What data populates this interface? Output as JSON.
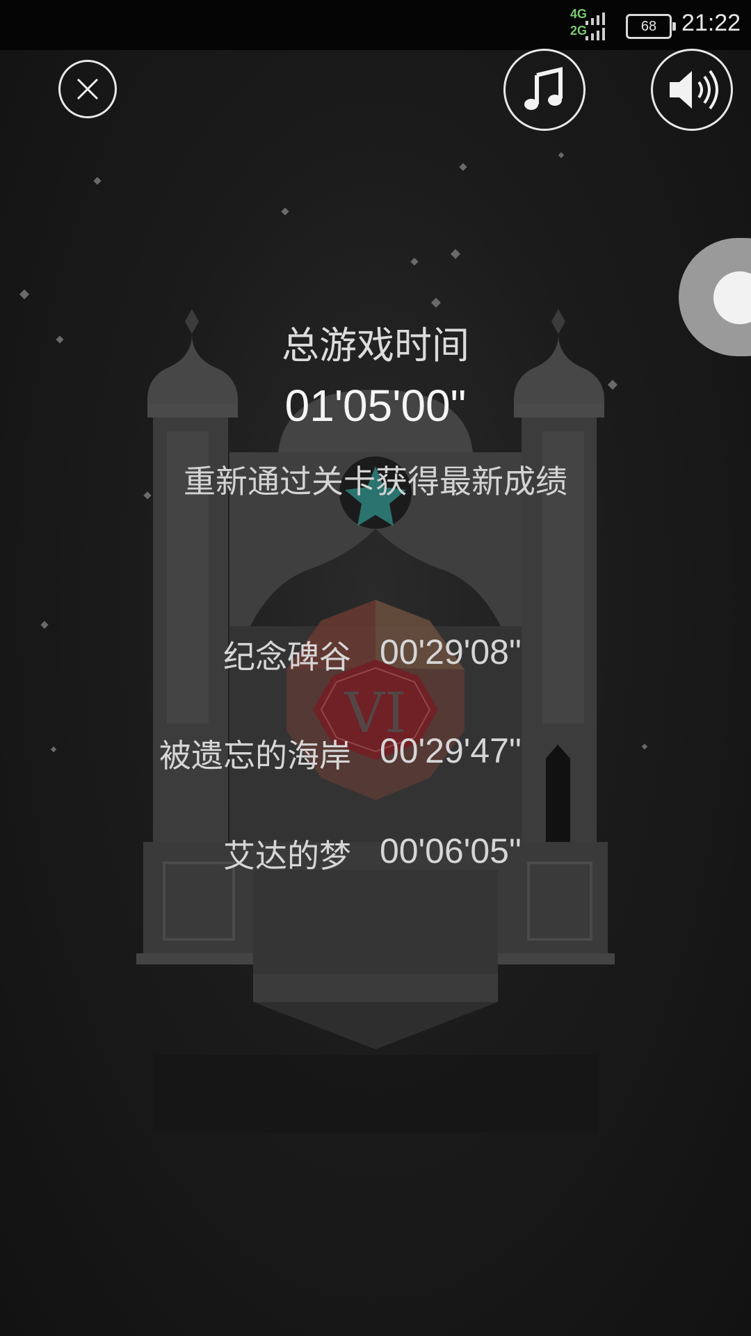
{
  "status_bar": {
    "network_top": "4G",
    "network_bottom": "2G",
    "battery": "68",
    "time": "21:22"
  },
  "controls": {
    "close_icon": "close-icon",
    "music_icon": "music-note-icon",
    "sound_icon": "speaker-volume-icon"
  },
  "summary": {
    "title": "总游戏时间",
    "total_time": "01'05'00\"",
    "hint": "重新通过关卡获得最新成绩"
  },
  "chapters": [
    {
      "name": "纪念碑谷",
      "time": "00'29'08\""
    },
    {
      "name": "被遗忘的海岸",
      "time": "00'29'47\""
    },
    {
      "name": "艾达的梦",
      "time": "00'06'05\""
    }
  ],
  "monument_numeral": "VI",
  "colors": {
    "background": "#1b1b1b",
    "monument": "#3e3e3e",
    "gem": "#8a1f24",
    "star": "#2f8a85"
  }
}
